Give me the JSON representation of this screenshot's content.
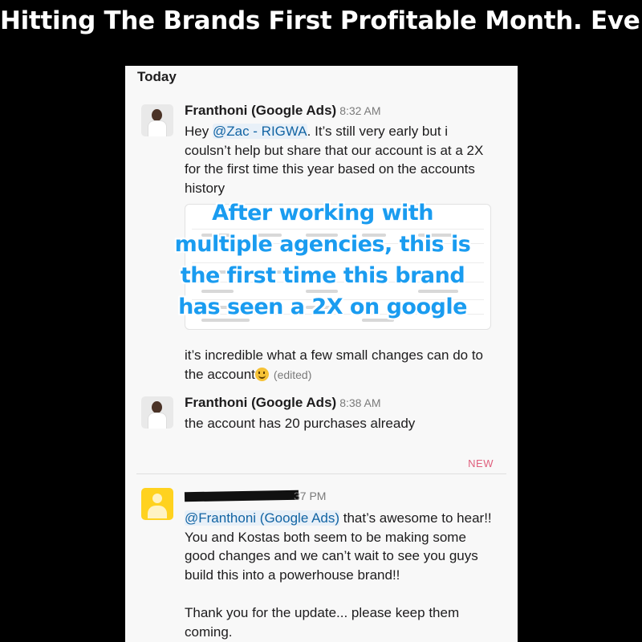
{
  "headline": "Hitting The Brands First Profitable Month. Ever",
  "day_label": "Today",
  "messages": [
    {
      "sender": "Franthoni (Google Ads)",
      "time": "8:32 AM",
      "text_prefix": "Hey ",
      "mention": "@Zac - RIGWA",
      "text_body": ". It’s still very early but i coulsn’t help but share that our account is at a 2X for the first time this year based on the accounts history",
      "text_after": "it’s incredible what a few small changes can do to the account",
      "edited": "(edited)"
    },
    {
      "sender": "Franthoni (Google Ads)",
      "time": "8:38 AM",
      "text": "the account has 20 purchases already"
    },
    {
      "sender_redacted": true,
      "time_partial": "37 PM",
      "mention": "@Franthoni (Google Ads)",
      "text_body": " that’s awesome to hear!! You and Kostas both seem to be making some good changes and we can’t wait to see you guys build this into a powerhouse brand!!",
      "text_line2": "Thank you for the update... please keep them coming."
    }
  ],
  "overlay_text": "After working with multiple agencies, this is the first time this brand has seen a 2X on google",
  "new_label": "NEW",
  "colors": {
    "mention": "#1264a3",
    "overlay": "#1a9cf0",
    "new": "#e0607e"
  }
}
